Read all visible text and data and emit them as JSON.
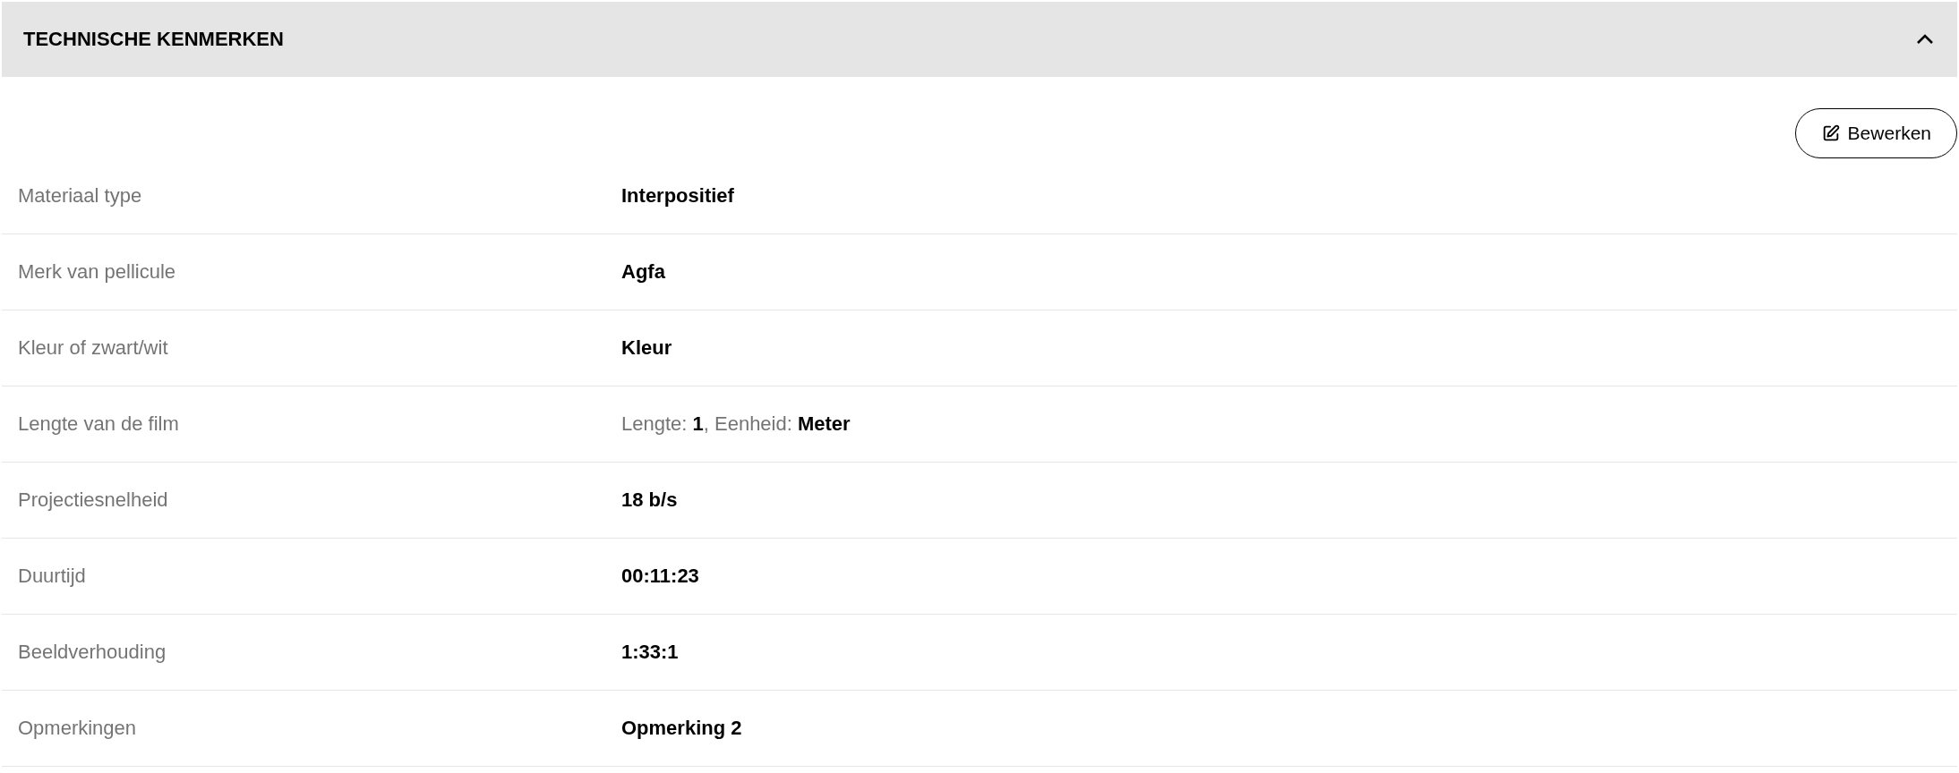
{
  "section": {
    "title": "TECHNISCHE KENMERKEN",
    "expanded": true
  },
  "edit_button": {
    "label": "Bewerken"
  },
  "rows": [
    {
      "label": "Materiaal type",
      "value": "Interpositief",
      "kind": "bold"
    },
    {
      "label": "Merk van pellicule",
      "value": "Agfa",
      "kind": "bold"
    },
    {
      "label": "Kleur of zwart/wit",
      "value": "Kleur",
      "kind": "bold"
    },
    {
      "label": "Lengte van de film",
      "value": "Lengte: **1**, Eenheid: **Meter**",
      "kind": "mixed"
    },
    {
      "label": "Projectiesnelheid",
      "value": "18 b/s",
      "kind": "bold"
    },
    {
      "label": "Duurtijd",
      "value": "00:11:23",
      "kind": "bold"
    },
    {
      "label": "Beeldverhouding",
      "value": "1:33:1",
      "kind": "bold"
    },
    {
      "label": "Opmerkingen",
      "value": "Opmerking 2",
      "kind": "bold"
    }
  ]
}
